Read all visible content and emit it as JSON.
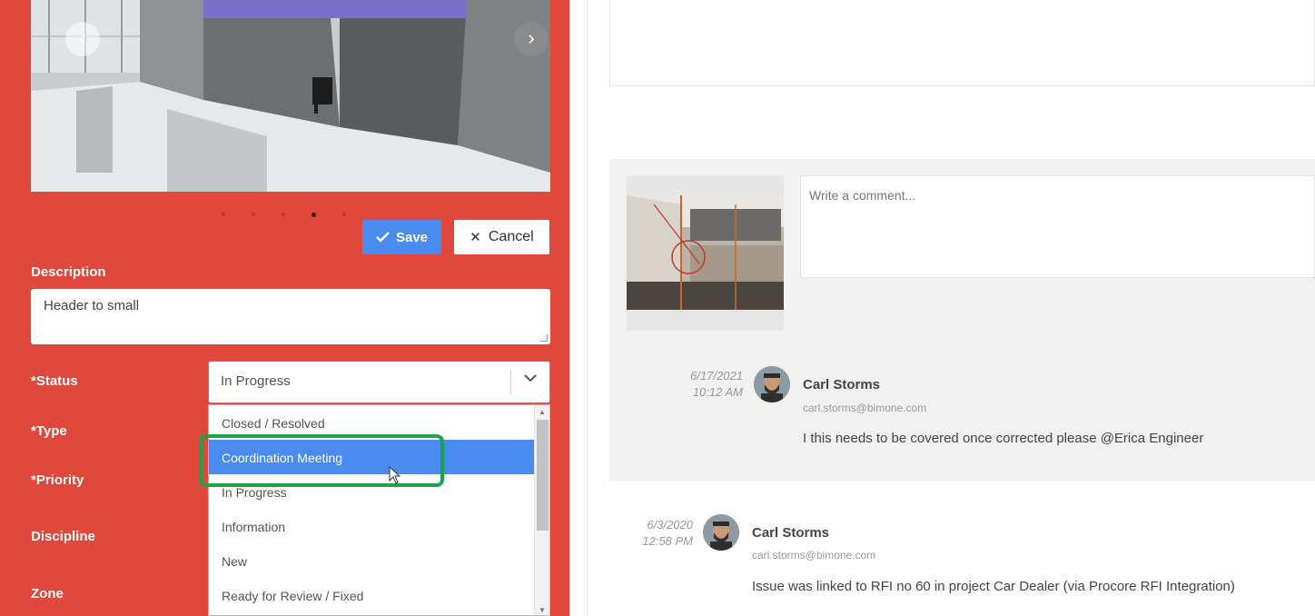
{
  "viewer": {
    "prev_icon": "chevron-left-icon",
    "next_icon": "chevron-right-icon",
    "slide_count": 5,
    "active_slide": 4
  },
  "actions": {
    "save_label": "Save",
    "cancel_label": "Cancel"
  },
  "form": {
    "description_label": "Description",
    "description_value": "Header to small",
    "status_label": "*Status",
    "status_value": "In Progress",
    "type_label": "*Type",
    "priority_label": "*Priority",
    "discipline_label": "Discipline",
    "zone_label": "Zone"
  },
  "dropdown": {
    "options": [
      "Closed / Resolved",
      "Coordination Meeting",
      "In Progress",
      "Information",
      "New",
      "Ready for Review / Fixed"
    ],
    "highlighted": "Coordination Meeting"
  },
  "comment_box": {
    "placeholder": "Write a comment..."
  },
  "comments": [
    {
      "date": "6/17/2021",
      "time": "10:12 AM",
      "name": "Carl Storms",
      "email": "carl.storms@bimone.com",
      "text": "I this needs to be covered once corrected please @Erica Engineer"
    },
    {
      "date": "6/3/2020",
      "time": "12:58 PM",
      "name": "Carl Storms",
      "email": "carl.storms@bimone.com",
      "text": "Issue was linked to RFI no 60 in project Car Dealer (via Procore RFI Integration)"
    }
  ],
  "colors": {
    "panel_red": "#e0483b",
    "accent_blue": "#4a8bf0",
    "highlight_green": "#1aa34a"
  }
}
